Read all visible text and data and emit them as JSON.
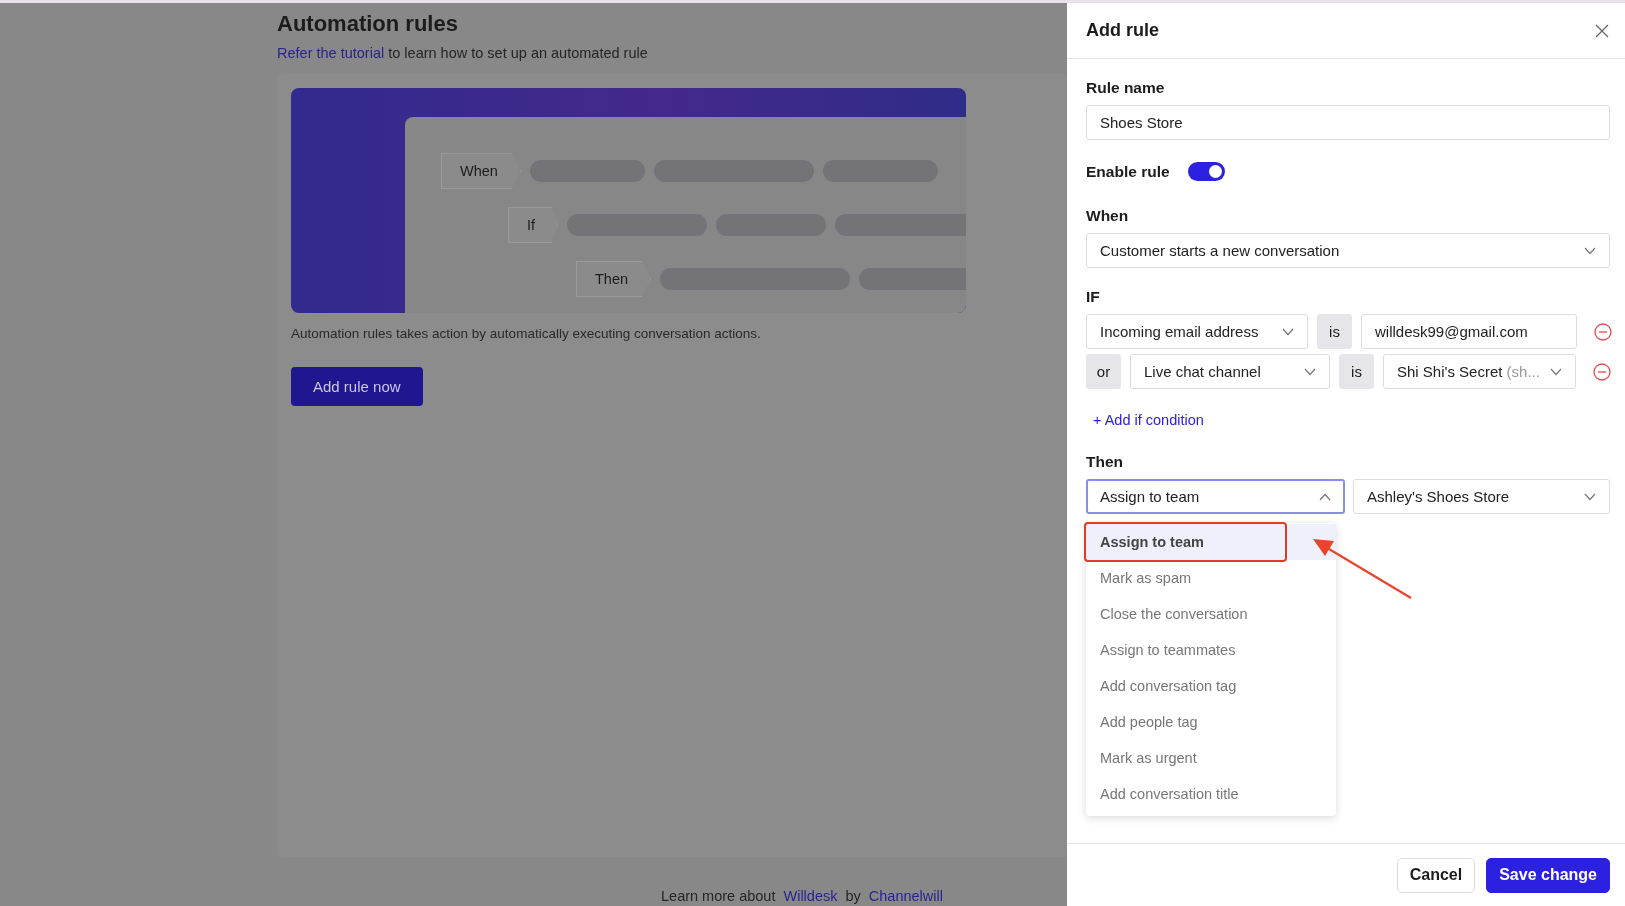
{
  "page": {
    "title": "Automation rules",
    "subtitle": {
      "link": "Refer the tutorial",
      "text": "to learn how to set up an automated rule"
    },
    "illustration": {
      "steps": [
        "When",
        "If",
        "Then"
      ]
    },
    "description": "Automation rules takes action by automatically executing conversation actions.",
    "button": "Add rule now",
    "footer": {
      "text": "Learn more about",
      "link_1": "Willdesk",
      "joiner": "by",
      "link_2": "Channelwill"
    }
  },
  "drawer": {
    "title": "Add rule",
    "rule_name": {
      "label": "Rule name",
      "value": "Shoes Store"
    },
    "enable_rule": {
      "label": "Enable rule",
      "on": true
    },
    "when": {
      "label": "When",
      "value": "Customer starts a new conversation"
    },
    "if": {
      "label": "IF",
      "conditions": [
        {
          "field": "Incoming email address",
          "operator": "is",
          "kind": "text",
          "value": "willdesk99@gmail.com"
        },
        {
          "connector": "or",
          "field": "Live chat channel",
          "operator": "is",
          "kind": "select",
          "value": "Shi Shi's Secret",
          "value_note": "(sh..."
        }
      ],
      "add": "+ Add if condition"
    },
    "then": {
      "label": "Then",
      "action": {
        "value": "Assign to team",
        "expanded": true,
        "options": [
          {
            "label": "Assign to team",
            "selected": true
          },
          {
            "label": "Mark as spam",
            "selected": false
          },
          {
            "label": "Close the conversation",
            "selected": false
          },
          {
            "label": "Assign to teammates",
            "selected": false
          },
          {
            "label": "Add conversation tag",
            "selected": false
          },
          {
            "label": "Add people tag",
            "selected": false
          },
          {
            "label": "Mark as urgent",
            "selected": false
          },
          {
            "label": "Add conversation title",
            "selected": false
          }
        ]
      },
      "target": {
        "value": "Ashley's Shoes Store"
      }
    },
    "buttons": {
      "cancel": "Cancel",
      "save": "Save change"
    }
  }
}
